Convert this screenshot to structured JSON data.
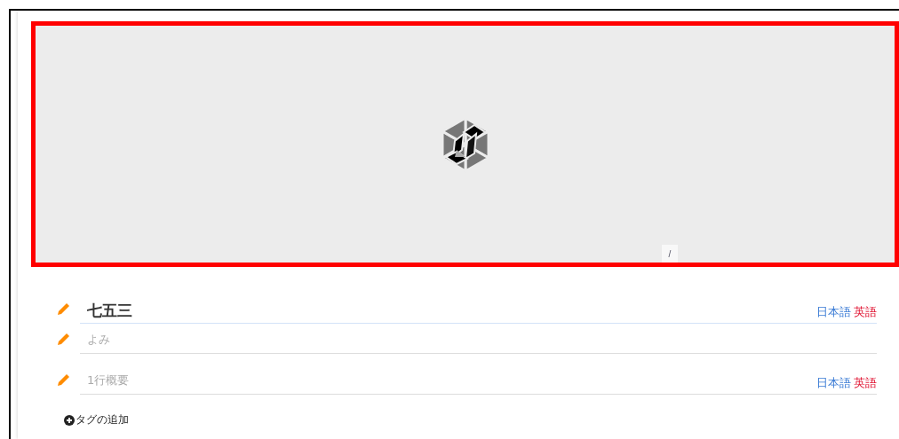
{
  "cover": {
    "caption_button": "/"
  },
  "fields": [
    {
      "value": "七五三",
      "languages": [
        {
          "label": "日本語",
          "color": "#3a7bd5"
        },
        {
          "label": "英語",
          "color": "#e0102f"
        }
      ]
    },
    {
      "placeholder": "よみ"
    },
    {
      "placeholder": "1行概要",
      "languages": [
        {
          "label": "日本語",
          "color": "#3a7bd5"
        },
        {
          "label": "英語",
          "color": "#e0102f"
        }
      ]
    }
  ],
  "add_tag": "タグの追加"
}
